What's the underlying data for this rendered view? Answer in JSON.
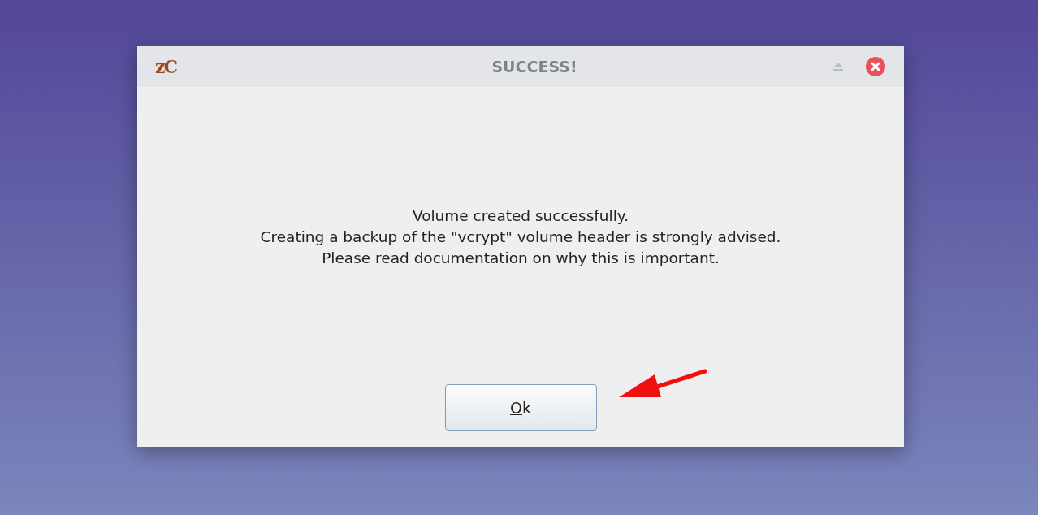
{
  "window": {
    "logo": "zC",
    "title": "SUCCESS!"
  },
  "message": [
    "Volume created successfully.",
    "Creating a backup of the \"vcrypt\" volume header is strongly advised.",
    "Please read documentation on why this is important."
  ],
  "buttons": [
    {
      "label": "Ok",
      "mnemonic": true
    }
  ]
}
